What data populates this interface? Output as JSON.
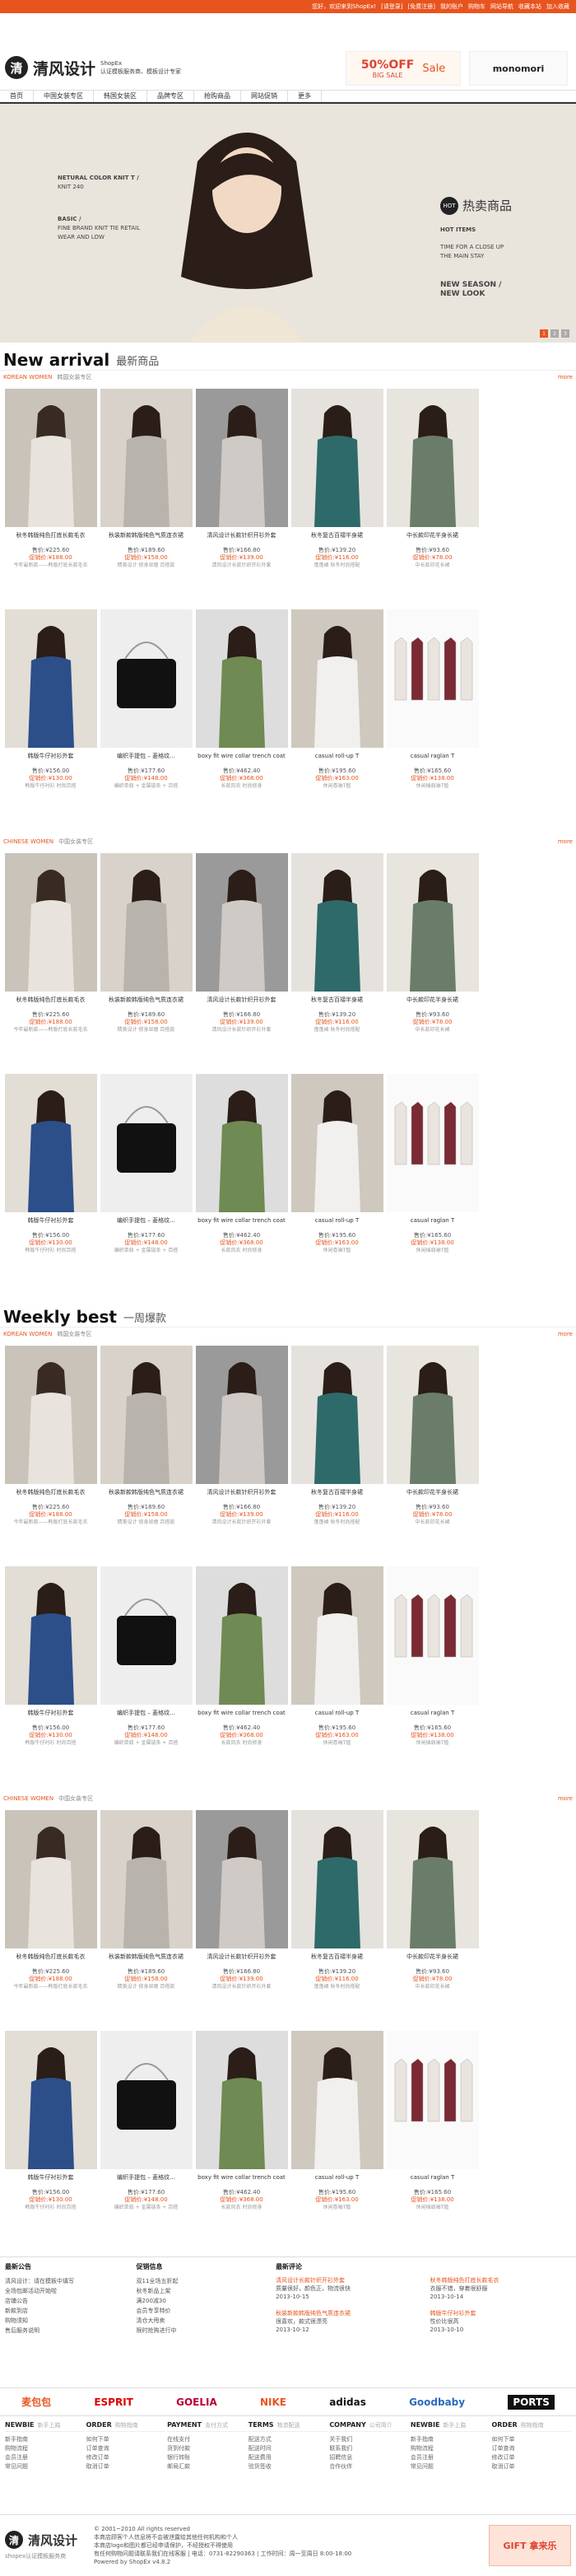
{
  "top_bar": {
    "items": [
      "您好，欢迎来到ShopEx!",
      "[请登录]",
      "[免费注册]",
      "我的账户",
      "购物车",
      "网站导航",
      "收藏本站",
      "加入收藏"
    ]
  },
  "header": {
    "logo_mark": "清",
    "logo_text": "清风设计",
    "logo_tag": "ShopEx",
    "logo_slogan": "认证模板服务商、模板设计专家",
    "banner1": {
      "big": "50%OFF",
      "label": "BIG SALE",
      "sub": "Sale"
    },
    "banner2": {
      "text": "monomori"
    }
  },
  "nav": [
    "首页",
    "中国女装专区",
    "韩国女装区",
    "品牌专区",
    "抢购商品",
    "网站促销",
    "更多"
  ],
  "hero": {
    "left_lines": [
      "NETURAL COLOR KNIT T /",
      "KNIT 240",
      "BASIC /",
      "FINE BRAND KNIT TIE RETAIL",
      "WEAR AND LOW"
    ],
    "hot_circle": "HOT",
    "hot_title": "热卖商品",
    "right_lines": [
      "HOT ITEMS",
      "TIME FOR A CLOSE UP",
      "THE MAIN STAY",
      "NEW SEASON /",
      "NEW LOOK"
    ],
    "dots": [
      "1",
      "2",
      "3"
    ]
  },
  "sections": [
    {
      "en": "New arrival",
      "cn": "最新商品"
    },
    {
      "en": "Weekly best",
      "cn": "一周爆款"
    }
  ],
  "sub_heads": [
    {
      "en": "KOREAN WOMEN",
      "cn": "韩国女装专区",
      "more": "more"
    },
    {
      "en": "CHINESE WOMEN",
      "cn": "中国女装专区",
      "more": "more"
    },
    {
      "en": "KOREAN WOMEN",
      "cn": "韩国女装专区",
      "more": "more"
    },
    {
      "en": "CHINESE WOMEN",
      "cn": "中国女装专区",
      "more": "more"
    }
  ],
  "products_row1": [
    {
      "name": "秋冬韩版纯色打底长款毛衣",
      "price": "售价:¥225.60",
      "sale": "促销价:¥188.00",
      "desc": "今年最新款——韩版打底长款毛衣"
    },
    {
      "name": "秋装新款韩版纯色气质连衣裙",
      "price": "售价:¥189.60",
      "sale": "促销价:¥158.00",
      "desc": "精美设计 修身显瘦 百搭款"
    },
    {
      "name": "清风设计长款针织开衫外套",
      "price": "售价:¥166.80",
      "sale": "促销价:¥139.00",
      "desc": "清风设计长款针织开衫外套"
    },
    {
      "name": "秋冬复古百褶半身裙",
      "price": "售价:¥139.20",
      "sale": "促销价:¥116.00",
      "desc": "蓬蓬裙 秋冬时尚搭配"
    },
    {
      "name": "中长款印花半身长裙",
      "price": "售价:¥93.60",
      "sale": "促销价:¥78.00",
      "desc": "中长款印花长裙"
    }
  ],
  "products_row2": [
    {
      "name": "韩版牛仔衬衫外套",
      "price": "售价:¥156.00",
      "sale": "促销价:¥130.00",
      "desc": "韩版牛仔衬衫 时尚百搭"
    },
    {
      "name": "编织手提包 – 菱格纹...",
      "price": "售价:¥177.60",
      "sale": "促销价:¥148.00",
      "desc": "编织单肩 + 金属链条 + 百搭"
    },
    {
      "name": "boxy fit wire collar trench coat",
      "price": "售价:¥462.40",
      "sale": "促销价:¥368.00",
      "desc": "长款风衣 时尚修身"
    },
    {
      "name": "casual roll-up T",
      "price": "售价:¥195.60",
      "sale": "促销价:¥163.00",
      "desc": "休闲卷袖T恤"
    },
    {
      "name": "casual raglan T",
      "price": "售价:¥165.60",
      "sale": "促销价:¥138.00",
      "desc": "休闲插肩袖T恤"
    }
  ],
  "footer": {
    "notice_title": "最新公告",
    "notices": [
      "清风设计：请在模板中填写",
      "全场包邮活动开始啦",
      "店铺公告",
      "新款到店",
      "购物须知",
      "售后服务说明"
    ],
    "info_title": "促销信息",
    "infos": [
      "双11全场五折起",
      "秋冬新品上架",
      "满200减30",
      "会员专享特价",
      "清仓大甩卖",
      "限时抢购进行中"
    ],
    "comment_title": "最新评论",
    "comments": [
      {
        "prod": "清风设计长款针织开衫外套",
        "text": "质量很好，颜色正，物流很快",
        "date": "2013-10-15"
      },
      {
        "prod": "秋冬韩版纯色打底长款毛衣",
        "text": "衣服不错，穿着很舒服",
        "date": "2013-10-14"
      },
      {
        "prod": "秋装新款韩版纯色气质连衣裙",
        "text": "很喜欢，款式很漂亮",
        "date": "2013-10-12"
      },
      {
        "prod": "韩版牛仔衬衫外套",
        "text": "性价比很高",
        "date": "2013-10-10"
      }
    ]
  },
  "brands": [
    "麦包包",
    "ESPRIT",
    "GOELIA",
    "NIKE",
    "adidas",
    "Goodbaby",
    "PORTS"
  ],
  "links": [
    {
      "en": "NEWBIE",
      "cn": "新手上路",
      "items": [
        "新手指南",
        "购物流程",
        "会员注册",
        "常见问题"
      ]
    },
    {
      "en": "ORDER",
      "cn": "购物指南",
      "items": [
        "如何下单",
        "订单查询",
        "修改订单",
        "取消订单"
      ]
    },
    {
      "en": "PAYMENT",
      "cn": "支付方式",
      "items": [
        "在线支付",
        "货到付款",
        "银行转账",
        "邮局汇款"
      ]
    },
    {
      "en": "TERMS",
      "cn": "物流配送",
      "items": [
        "配送方式",
        "配送时间",
        "配送费用",
        "验货签收"
      ]
    },
    {
      "en": "COMPANY",
      "cn": "公司简介",
      "items": [
        "关于我们",
        "联系我们",
        "招聘信息",
        "合作伙伴"
      ]
    },
    {
      "en": "NEWBIE",
      "cn": "新手上路",
      "items": [
        "新手指南",
        "购物流程",
        "会员注册",
        "常见问题"
      ]
    },
    {
      "en": "ORDER",
      "cn": "购物指南",
      "items": [
        "如何下单",
        "订单查询",
        "修改订单",
        "取消订单"
      ]
    }
  ],
  "bottom": {
    "logo": "清风设计",
    "logo_url": "shopex认证模板服务商",
    "copy": [
      "© 2001~2010 All rights reserved",
      "本商店顾客个人信息将不会被泄露给其他任何机构和个人",
      "本商店logo和图片都已经申请保护，不经授权不得使用",
      "有任何购物问题请联系我们在线客服 | 电话：0731-82290363 | 工作时间：周一至周日 8:00-18:00",
      "Powered by ShopEx v4.8.2"
    ],
    "gift": "GIFT 拿来乐"
  },
  "colors": {
    "accent": "#e8541e",
    "dark": "#222222"
  }
}
